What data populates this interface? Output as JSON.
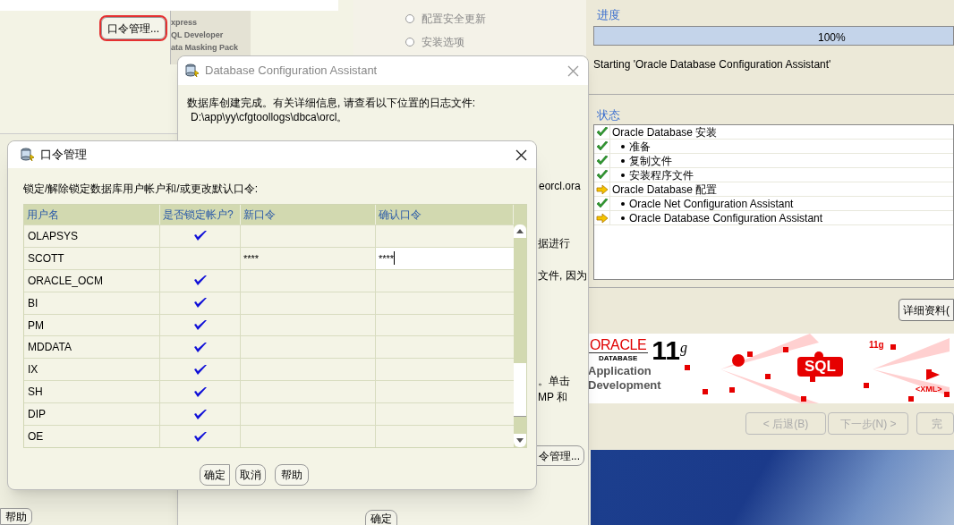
{
  "back_window": {
    "button": "口令管理...",
    "highlighted": true,
    "products": [
      "xpress",
      "QL Developer",
      "ata Masking Pack"
    ]
  },
  "installer": {
    "steps": [
      {
        "label": "配置安全更新",
        "selected": false
      },
      {
        "label": "安装选项",
        "selected": false
      }
    ],
    "progress": {
      "title": "进度",
      "level": 1,
      "reading": "100%",
      "message": "Starting 'Oracle Database Configuration Assistant'"
    },
    "status": {
      "title": "状态",
      "items": [
        {
          "label": "Oracle Database 安装",
          "done": true,
          "children": [
            {
              "label": "准备",
              "done": true
            },
            {
              "label": "复制文件",
              "done": true
            },
            {
              "label": "安装程序文件",
              "done": true
            }
          ]
        },
        {
          "label": "Oracle Database 配置",
          "done": false,
          "children": [
            {
              "label": "Oracle Net Configuration Assistant",
              "done": true
            },
            {
              "label": "Oracle Database Configuration Assistant",
              "done": false
            }
          ]
        }
      ]
    },
    "details_button": "详细资料(",
    "banner": {
      "brand": "ORACLE",
      "product": "DATABASE",
      "version": "11",
      "version_sup": "g",
      "subtitle": [
        "Application",
        "Development"
      ],
      "tag": "SQL",
      "small_tags": [
        "11g",
        "<XML>"
      ]
    },
    "nav_buttons": [
      {
        "label": "< 后退(B)",
        "disabled": true
      },
      {
        "label": "下一步(N) >",
        "disabled": true
      },
      {
        "label": "完",
        "disabled": true
      }
    ]
  },
  "dbca_dialog": {
    "title": "Database Configuration Assistant",
    "message": "数据库创建完成。有关详细信息, 请查看以下位置的日志文件:",
    "path": "D:\\app\\yy\\cfgtoollogs\\dbca\\orcl。",
    "fragments": [
      "eorcl.ora",
      "据进行",
      "文件, 因为",
      "。单击",
      "MP 和"
    ],
    "password_button": "令管理...",
    "ok_button": "确定"
  },
  "side_window": {
    "help_button": "帮助"
  },
  "password_dialog": {
    "title": "口令管理",
    "instruction": "锁定/解除锁定数据库用户帐户和/或更改默认口令:",
    "columns": [
      "用户名",
      "是否锁定帐户?",
      "新口令",
      "确认口令"
    ],
    "rows": [
      {
        "user": "OLAPSYS",
        "locked": true,
        "editing": false
      },
      {
        "user": "SCOTT",
        "locked": false,
        "new_password": "****",
        "confirm_password": "****",
        "editing": true
      },
      {
        "user": "ORACLE_OCM",
        "locked": true,
        "editing": false
      },
      {
        "user": "BI",
        "locked": true,
        "editing": false
      },
      {
        "user": "PM",
        "locked": true,
        "editing": false
      },
      {
        "user": "MDDATA",
        "locked": true,
        "editing": false
      },
      {
        "user": "IX",
        "locked": true,
        "editing": false
      },
      {
        "user": "SH",
        "locked": true,
        "editing": false
      },
      {
        "user": "DIP",
        "locked": true,
        "editing": false
      },
      {
        "user": "OE",
        "locked": true,
        "editing": false
      }
    ],
    "buttons": [
      "确定",
      "取消",
      "帮助"
    ]
  }
}
